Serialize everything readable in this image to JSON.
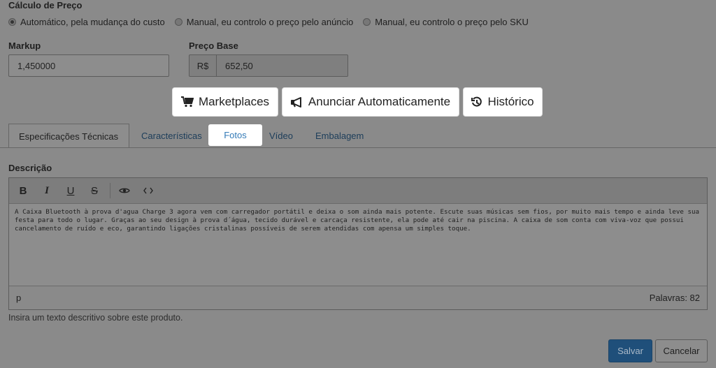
{
  "pricing": {
    "title": "Cálculo de Preço",
    "options": [
      {
        "label": "Automático, pela mudança do custo",
        "checked": true
      },
      {
        "label": "Manual, eu controlo o preço pelo anúncio",
        "checked": false
      },
      {
        "label": "Manual, eu controlo o preço pelo SKU",
        "checked": false
      }
    ]
  },
  "markup": {
    "label": "Markup",
    "value": "1,450000"
  },
  "base_price": {
    "label": "Preço Base",
    "currency": "R$",
    "value": "652,50"
  },
  "action_buttons": {
    "marketplaces": "Marketplaces",
    "auto_announce": "Anunciar Automaticamente",
    "history": "Histórico"
  },
  "tabs": [
    {
      "label": "Especificações Técnicas",
      "active": true
    },
    {
      "label": "Características",
      "active": false
    },
    {
      "label": "Fotos",
      "active": false
    },
    {
      "label": "Vídeo",
      "active": false
    },
    {
      "label": "Embalagem",
      "active": false
    }
  ],
  "description": {
    "label": "Descrição",
    "text": "A Caixa Bluetooth à prova d'agua Charge 3 agora vem com carregador portátil e deixa o som ainda mais potente. Escute suas músicas sem fios, por muito mais tempo e ainda leve sua festa para todo o lugar. Graças ao seu design à prova d´água, tecido durável e carcaça resistente, ela pode até cair na piscina. A caixa de som conta com viva-voz que possui cancelamento de ruído e eco, garantindo ligações cristalinas possíveis de serem atendidas com apensa um simples toque.",
    "status_path": "p",
    "word_count": "Palavras: 82",
    "help": "Insira um texto descritivo sobre este produto."
  },
  "toolbar": {
    "bold": "B",
    "italic": "I",
    "underline": "U",
    "strike": "S"
  },
  "footer": {
    "save": "Salvar",
    "cancel": "Cancelar"
  }
}
